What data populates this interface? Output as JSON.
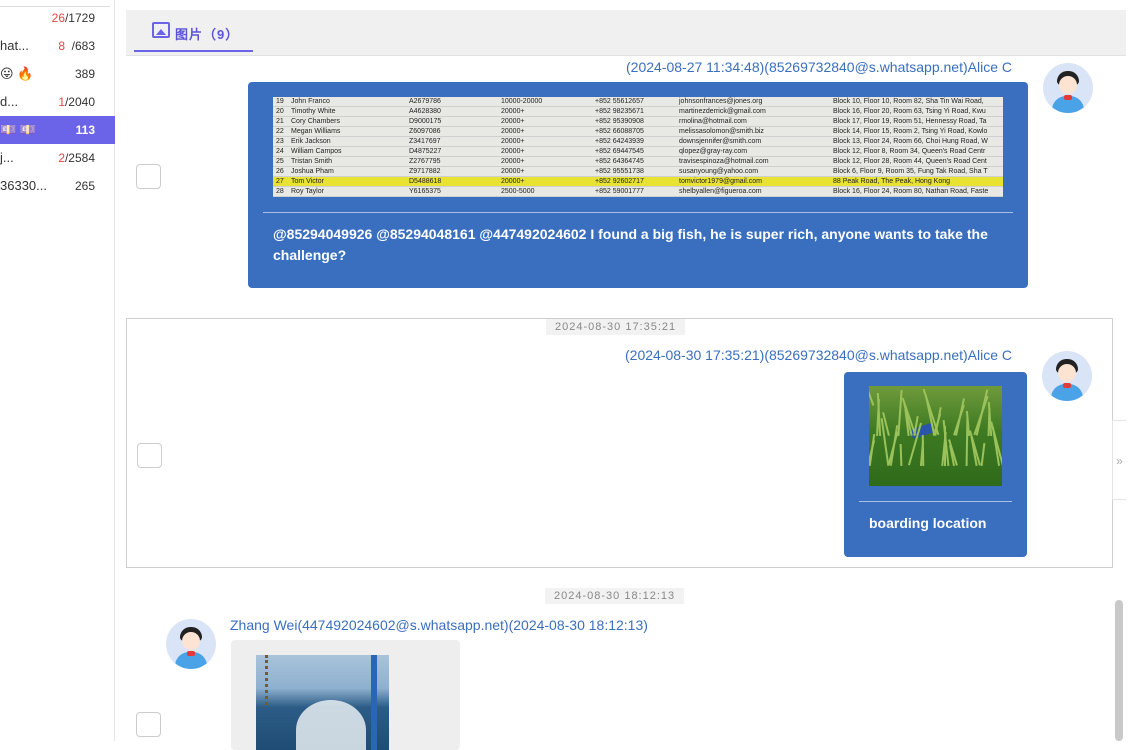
{
  "sidebar": {
    "items": [
      {
        "name": "",
        "unread": "26",
        "total": "/1729"
      },
      {
        "name": "hat...",
        "unread": "8",
        "total": "/683"
      },
      {
        "name": "😛 🔥 R...",
        "unread": "",
        "total": "389"
      },
      {
        "name": "d...",
        "unread": "1",
        "total": "/2040"
      },
      {
        "name": "💷 💷 ...",
        "unread": "",
        "total": "113"
      },
      {
        "name": "j...",
        "unread": "2",
        "total": "/2584"
      },
      {
        "name": "36330...",
        "unread": "",
        "total": "265"
      }
    ]
  },
  "tab": {
    "label": "图片（9）",
    "icon": "image-icon"
  },
  "messages": [
    {
      "sender": "(2024-08-27 11:34:48)(85269732840@s.whatsapp.net)Alice C",
      "caption": "@85294049926 @85294048161 @447492024602 I found a big fish, he is super rich, anyone wants to take the challenge?",
      "sheet_rows": [
        {
          "n": "19",
          "name": "John Franco",
          "id": "A2679786",
          "range": "10000-20000",
          "phone": "+852 55612657",
          "email": "johnsonfrances@jones.org",
          "addr": "Block 10, Floor 10, Room 82, Sha Tin Wai Road,"
        },
        {
          "n": "20",
          "name": "Timothy White",
          "id": "A4628380",
          "range": "20000+",
          "phone": "+852 98235671",
          "email": "martinezderrick@gmail.com",
          "addr": "Block 16, Floor 20, Room 63, Tsing Yi Road, Kwu"
        },
        {
          "n": "21",
          "name": "Cory Chambers",
          "id": "D9000175",
          "range": "20000+",
          "phone": "+852 95390908",
          "email": "rmolina@hotmail.com",
          "addr": "Block 17, Floor 19, Room 51, Hennessy Road, Ta"
        },
        {
          "n": "22",
          "name": "Megan Williams",
          "id": "Z6097086",
          "range": "20000+",
          "phone": "+852 66088705",
          "email": "melissasolomon@smith.biz",
          "addr": "Block 14, Floor 15, Room 2, Tsing Yi Road, Kowlo"
        },
        {
          "n": "23",
          "name": "Erik Jackson",
          "id": "Z3417697",
          "range": "20000+",
          "phone": "+852 64243939",
          "email": "downsjennifer@smith.com",
          "addr": "Block 13, Floor 24, Room 66, Choi Hung Road, W"
        },
        {
          "n": "24",
          "name": "William Campos",
          "id": "D4875227",
          "range": "20000+",
          "phone": "+852 69447545",
          "email": "qlopez@gray-ray.com",
          "addr": "Block 12, Floor 8, Room 34, Queen's Road Centr"
        },
        {
          "n": "25",
          "name": "Tristan Smith",
          "id": "Z2767795",
          "range": "20000+",
          "phone": "+852 64364745",
          "email": "travisespinoza@hotmail.com",
          "addr": "Block 12, Floor 28, Room 44, Queen's Road Cent"
        },
        {
          "n": "26",
          "name": "Joshua Pham",
          "id": "Z9717882",
          "range": "20000+",
          "phone": "+852 95551738",
          "email": "susanyoung@yahoo.com",
          "addr": "Block 6, Floor 9, Room 35, Fung Tak Road, Sha T"
        },
        {
          "n": "27",
          "name": "Tom Victor",
          "id": "D5488618",
          "range": "20000+",
          "phone": "+852 92602717",
          "email": "tomvictor1979@gmail.com",
          "addr": "88 Peak Road, The Peak, Hong Kong",
          "highlight": true
        },
        {
          "n": "28",
          "name": "Roy Taylor",
          "id": "Y6165375",
          "range": "2500-5000",
          "phone": "+852 59001777",
          "email": "shelbyallen@figueroa.com",
          "addr": "Block 16, Floor 24, Room 80, Nathan Road, Faste"
        }
      ]
    },
    {
      "time_chip": "2024-08-30 17:35:21",
      "sender": "(2024-08-30 17:35:21)(85269732840@s.whatsapp.net)Alice C",
      "caption": "boarding location"
    },
    {
      "time_chip": "2024-08-30 18:12:13",
      "sender": "Zhang Wei(447492024602@s.whatsapp.net)(2024-08-30 18:12:13)"
    }
  ],
  "colors": {
    "accent": "#6b63e8",
    "bubble": "#3a6fbf",
    "link": "#3a6fbd",
    "unread": "#e64545"
  },
  "handle": "»"
}
